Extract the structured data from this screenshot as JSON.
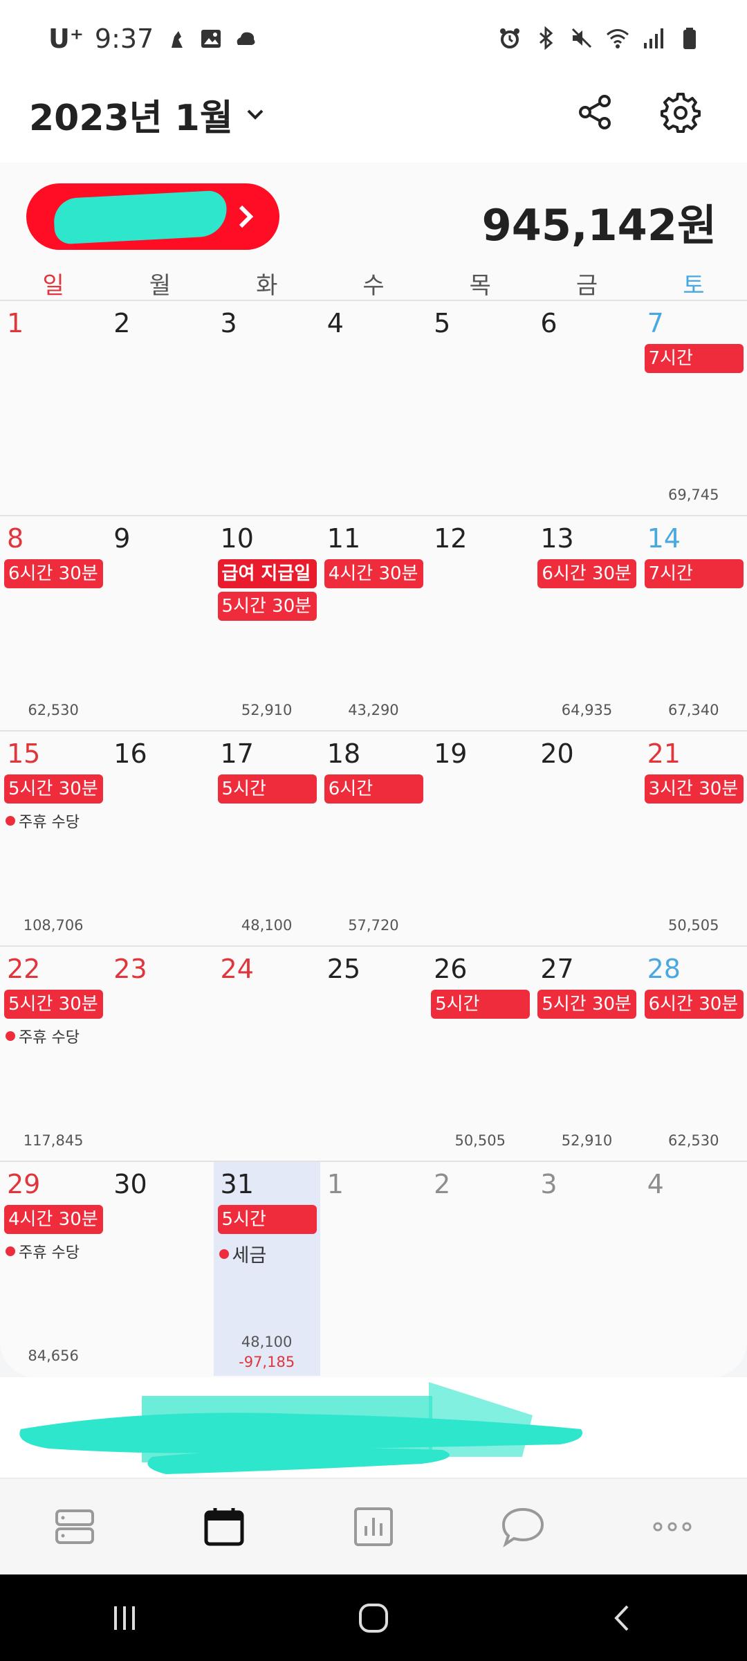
{
  "status_bar": {
    "carrier": "U⁺",
    "time": "9:37",
    "icons": [
      "bixby-icon",
      "gallery-icon",
      "cloud-icon",
      "alarm-icon",
      "bluetooth-icon",
      "mute-icon",
      "wifi-icon",
      "signal-icon",
      "battery-icon"
    ]
  },
  "header": {
    "title": "2023년 1월",
    "icons": [
      "chevron-down-icon",
      "share-icon",
      "gear-icon"
    ]
  },
  "summary": {
    "total": "945,142원"
  },
  "weekdays": [
    "일",
    "월",
    "화",
    "수",
    "목",
    "금",
    "토"
  ],
  "weeks": [
    [
      {
        "day": "1",
        "color": "red"
      },
      {
        "day": "2"
      },
      {
        "day": "3"
      },
      {
        "day": "4"
      },
      {
        "day": "5"
      },
      {
        "day": "6"
      },
      {
        "day": "7",
        "color": "blue",
        "badges": [
          "7시간"
        ],
        "amount": "69,745"
      }
    ],
    [
      {
        "day": "8",
        "color": "red",
        "badges": [
          "6시간 30분"
        ],
        "amount": "62,530"
      },
      {
        "day": "9"
      },
      {
        "day": "10",
        "badges": [
          "급여 지급일",
          "5시간 30분"
        ],
        "amount": "52,910"
      },
      {
        "day": "11",
        "badges": [
          "4시간 30분"
        ],
        "amount": "43,290"
      },
      {
        "day": "12"
      },
      {
        "day": "13",
        "badges": [
          "6시간 30분"
        ],
        "amount": "64,935"
      },
      {
        "day": "14",
        "color": "blue",
        "badges": [
          "7시간"
        ],
        "amount": "67,340"
      }
    ],
    [
      {
        "day": "15",
        "color": "red",
        "badges": [
          "5시간 30분"
        ],
        "notes": [
          "주휴 수당"
        ],
        "amount": "108,706"
      },
      {
        "day": "16"
      },
      {
        "day": "17",
        "badges": [
          "5시간"
        ],
        "amount": "48,100"
      },
      {
        "day": "18",
        "badges": [
          "6시간"
        ],
        "amount": "57,720"
      },
      {
        "day": "19"
      },
      {
        "day": "20"
      },
      {
        "day": "21",
        "color": "red",
        "badges": [
          "3시간 30분"
        ],
        "amount": "50,505"
      }
    ],
    [
      {
        "day": "22",
        "color": "red",
        "badges": [
          "5시간 30분"
        ],
        "notes": [
          "주휴 수당"
        ],
        "amount": "117,845"
      },
      {
        "day": "23",
        "color": "red"
      },
      {
        "day": "24",
        "color": "red"
      },
      {
        "day": "25"
      },
      {
        "day": "26",
        "badges": [
          "5시간"
        ],
        "amount": "50,505"
      },
      {
        "day": "27",
        "badges": [
          "5시간 30분"
        ],
        "amount": "52,910"
      },
      {
        "day": "28",
        "color": "blue",
        "badges": [
          "6시간 30분"
        ],
        "amount": "62,530"
      }
    ],
    [
      {
        "day": "29",
        "color": "red",
        "badges": [
          "4시간 30분"
        ],
        "notes": [
          "주휴 수당"
        ],
        "amount": "84,656"
      },
      {
        "day": "30"
      },
      {
        "day": "31",
        "today": true,
        "badges": [
          "5시간"
        ],
        "notes_big": [
          "세금"
        ],
        "amount": "48,100",
        "amount2": "-97,185"
      },
      {
        "day": "1",
        "color": "muted"
      },
      {
        "day": "2",
        "color": "muted"
      },
      {
        "day": "3",
        "color": "muted"
      },
      {
        "day": "4",
        "color": "muted"
      }
    ]
  ],
  "bottom_nav": [
    "list-icon",
    "calendar-icon",
    "chart-icon",
    "chat-icon",
    "more-icon"
  ],
  "system_nav": [
    "recents-icon",
    "home-icon",
    "back-icon"
  ],
  "colors": {
    "accent_red": "#ef2c3c",
    "sunday_red": "#e0353b",
    "saturday_blue": "#4aa8e0",
    "today_bg": "#e4e9f8",
    "redaction": "#2ee6cb"
  }
}
